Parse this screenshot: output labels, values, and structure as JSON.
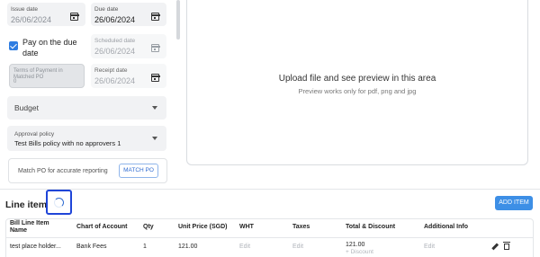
{
  "form": {
    "issue_date": {
      "label": "Issue date",
      "value": "26/06/2024"
    },
    "due_date": {
      "label": "Due date",
      "value": "26/06/2024"
    },
    "pay_on_due_date": {
      "label_line1": "Pay on the due",
      "label_line2": "date",
      "checked": true
    },
    "scheduled_date": {
      "label": "Scheduled date",
      "value": "26/06/2024"
    },
    "terms_of_payment": {
      "label_line1": "Terms of Payment in",
      "label_line2": "Matched PO",
      "value": "0"
    },
    "receipt_date": {
      "label": "Receipt date",
      "value": "26/06/2024"
    },
    "budget": {
      "placeholder": "Budget"
    },
    "approval_policy": {
      "label": "Approval policy",
      "value": "Test Bills policy with no approvers 1"
    },
    "match_po": {
      "text": "Match PO for accurate reporting",
      "button": "MATCH PO"
    }
  },
  "upload": {
    "title": "Upload file and see preview in this area",
    "subtitle": "Preview works only for pdf, png and jpg"
  },
  "line_items": {
    "title": "Line items",
    "add_button": "ADD ITEM",
    "columns": {
      "name_l1": "Bill Line Item",
      "name_l2": "Name",
      "account": "Chart of Account",
      "qty": "Qty",
      "unit_price": "Unit Price (SGD)",
      "wht": "WHT",
      "taxes": "Taxes",
      "total": "Total & Discount",
      "info": "Additional Info"
    },
    "rows": [
      {
        "name": "test place holder...",
        "account": "Bank Fees",
        "qty": "1",
        "unit_price": "121.00",
        "wht": "Edit",
        "taxes": "Edit",
        "total": "121.00",
        "discount": "+ Discount",
        "info": "Edit"
      }
    ]
  },
  "colors": {
    "accent": "#3d8fe6",
    "highlight_box": "#1f45d8",
    "field_bg": "#f1f2f4"
  }
}
